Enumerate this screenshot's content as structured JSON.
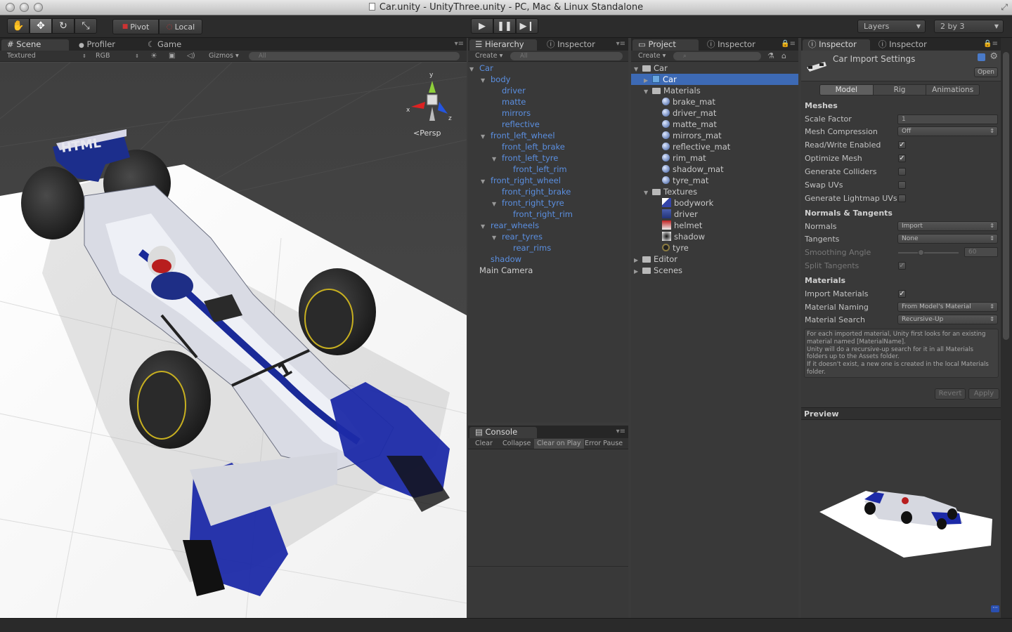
{
  "window": {
    "title": "Car.unity - UnityThree.unity - PC, Mac & Linux Standalone"
  },
  "toolbar": {
    "pivot": "Pivot",
    "local": "Local",
    "layers": "Layers",
    "layout": "2 by 3"
  },
  "scene_panel": {
    "tabs": [
      "Scene",
      "Profiler",
      "Game"
    ],
    "render_mode": "Textured",
    "color_mode": "RGB",
    "gizmos": "Gizmos",
    "search_placeholder": "All",
    "persp": "Persp",
    "axis_y": "y",
    "axis_x": "x",
    "axis_z": "z",
    "car_livery_text": "HTML",
    "car_number": "1"
  },
  "hierarchy_panel": {
    "tabs": [
      "Hierarchy",
      "Inspector"
    ],
    "create": "Create",
    "search_placeholder": "All",
    "items": [
      {
        "label": "Car",
        "depth": 0,
        "arrow": "open",
        "color": "blue"
      },
      {
        "label": "body",
        "depth": 1,
        "arrow": "open",
        "color": "blue"
      },
      {
        "label": "driver",
        "depth": 2,
        "arrow": "",
        "color": "blue"
      },
      {
        "label": "matte",
        "depth": 2,
        "arrow": "",
        "color": "blue"
      },
      {
        "label": "mirrors",
        "depth": 2,
        "arrow": "",
        "color": "blue"
      },
      {
        "label": "reflective",
        "depth": 2,
        "arrow": "",
        "color": "blue"
      },
      {
        "label": "front_left_wheel",
        "depth": 1,
        "arrow": "open",
        "color": "blue"
      },
      {
        "label": "front_left_brake",
        "depth": 2,
        "arrow": "",
        "color": "blue"
      },
      {
        "label": "front_left_tyre",
        "depth": 2,
        "arrow": "open",
        "color": "blue"
      },
      {
        "label": "front_left_rim",
        "depth": 3,
        "arrow": "",
        "color": "blue"
      },
      {
        "label": "front_right_wheel",
        "depth": 1,
        "arrow": "open",
        "color": "blue"
      },
      {
        "label": "front_right_brake",
        "depth": 2,
        "arrow": "",
        "color": "blue"
      },
      {
        "label": "front_right_tyre",
        "depth": 2,
        "arrow": "open",
        "color": "blue"
      },
      {
        "label": "front_right_rim",
        "depth": 3,
        "arrow": "",
        "color": "blue"
      },
      {
        "label": "rear_wheels",
        "depth": 1,
        "arrow": "open",
        "color": "blue"
      },
      {
        "label": "rear_tyres",
        "depth": 2,
        "arrow": "open",
        "color": "blue"
      },
      {
        "label": "rear_rims",
        "depth": 3,
        "arrow": "",
        "color": "blue"
      },
      {
        "label": "shadow",
        "depth": 1,
        "arrow": "",
        "color": "blue"
      },
      {
        "label": "Main Camera",
        "depth": 0,
        "arrow": "",
        "color": "white"
      }
    ]
  },
  "console_panel": {
    "tab": "Console",
    "buttons": [
      "Clear",
      "Collapse",
      "Clear on Play",
      "Error Pause"
    ]
  },
  "project_panel": {
    "tabs": [
      "Project",
      "Inspector"
    ],
    "create": "Create",
    "items": [
      {
        "label": "Car",
        "depth": 0,
        "arrow": "open",
        "icon": "folder"
      },
      {
        "label": "Car",
        "depth": 1,
        "arrow": "closed",
        "icon": "prefab",
        "selected": true
      },
      {
        "label": "Materials",
        "depth": 1,
        "arrow": "open",
        "icon": "folder"
      },
      {
        "label": "brake_mat",
        "depth": 2,
        "arrow": "",
        "icon": "material"
      },
      {
        "label": "driver_mat",
        "depth": 2,
        "arrow": "",
        "icon": "material"
      },
      {
        "label": "matte_mat",
        "depth": 2,
        "arrow": "",
        "icon": "material"
      },
      {
        "label": "mirrors_mat",
        "depth": 2,
        "arrow": "",
        "icon": "material"
      },
      {
        "label": "reflective_mat",
        "depth": 2,
        "arrow": "",
        "icon": "material"
      },
      {
        "label": "rim_mat",
        "depth": 2,
        "arrow": "",
        "icon": "material"
      },
      {
        "label": "shadow_mat",
        "depth": 2,
        "arrow": "",
        "icon": "material"
      },
      {
        "label": "tyre_mat",
        "depth": 2,
        "arrow": "",
        "icon": "material"
      },
      {
        "label": "Textures",
        "depth": 1,
        "arrow": "open",
        "icon": "folder"
      },
      {
        "label": "bodywork",
        "depth": 2,
        "arrow": "",
        "icon": "texture-bodywork"
      },
      {
        "label": "driver",
        "depth": 2,
        "arrow": "",
        "icon": "texture-driver"
      },
      {
        "label": "helmet",
        "depth": 2,
        "arrow": "",
        "icon": "texture-helmet"
      },
      {
        "label": "shadow",
        "depth": 2,
        "arrow": "",
        "icon": "texture-shadow"
      },
      {
        "label": "tyre",
        "depth": 2,
        "arrow": "",
        "icon": "texture-tyre"
      },
      {
        "label": "Editor",
        "depth": 0,
        "arrow": "closed",
        "icon": "folder"
      },
      {
        "label": "Scenes",
        "depth": 0,
        "arrow": "closed",
        "icon": "folder"
      }
    ]
  },
  "inspector_panel": {
    "tab": "Inspector",
    "header_title": "Car Import Settings",
    "open_button": "Open",
    "tabs": [
      "Model",
      "Rig",
      "Animations"
    ],
    "active_tab": "Model",
    "sections": {
      "meshes": "Meshes",
      "normals": "Normals & Tangents",
      "materials": "Materials"
    },
    "fields": {
      "scale_factor": {
        "label": "Scale Factor",
        "value": "1"
      },
      "mesh_compression": {
        "label": "Mesh Compression",
        "value": "Off"
      },
      "read_write": {
        "label": "Read/Write Enabled",
        "checked": true
      },
      "optimize_mesh": {
        "label": "Optimize Mesh",
        "checked": true
      },
      "generate_colliders": {
        "label": "Generate Colliders",
        "checked": false
      },
      "swap_uvs": {
        "label": "Swap UVs",
        "checked": false
      },
      "lightmap_uvs": {
        "label": "Generate Lightmap UVs",
        "checked": false
      },
      "normals": {
        "label": "Normals",
        "value": "Import"
      },
      "tangents": {
        "label": "Tangents",
        "value": "None"
      },
      "smoothing_angle": {
        "label": "Smoothing Angle",
        "value": "60"
      },
      "split_tangents": {
        "label": "Split Tangents",
        "checked": true
      },
      "import_materials": {
        "label": "Import Materials",
        "checked": true
      },
      "material_naming": {
        "label": "Material Naming",
        "value": "From Model's Material"
      },
      "material_search": {
        "label": "Material Search",
        "value": "Recursive-Up"
      }
    },
    "help_text": "For each imported material, Unity first looks for an existing material named [MaterialName].\nUnity will do a recursive-up search for it in all Materials folders up to the Assets folder.\nIf it doesn't exist, a new one is created in the local Materials folder.",
    "revert": "Revert",
    "apply": "Apply",
    "preview_title": "Preview"
  },
  "colors": {
    "accent_blue": "#5b8fe0",
    "selection": "#3d6ab5",
    "panel_bg": "#393939"
  }
}
